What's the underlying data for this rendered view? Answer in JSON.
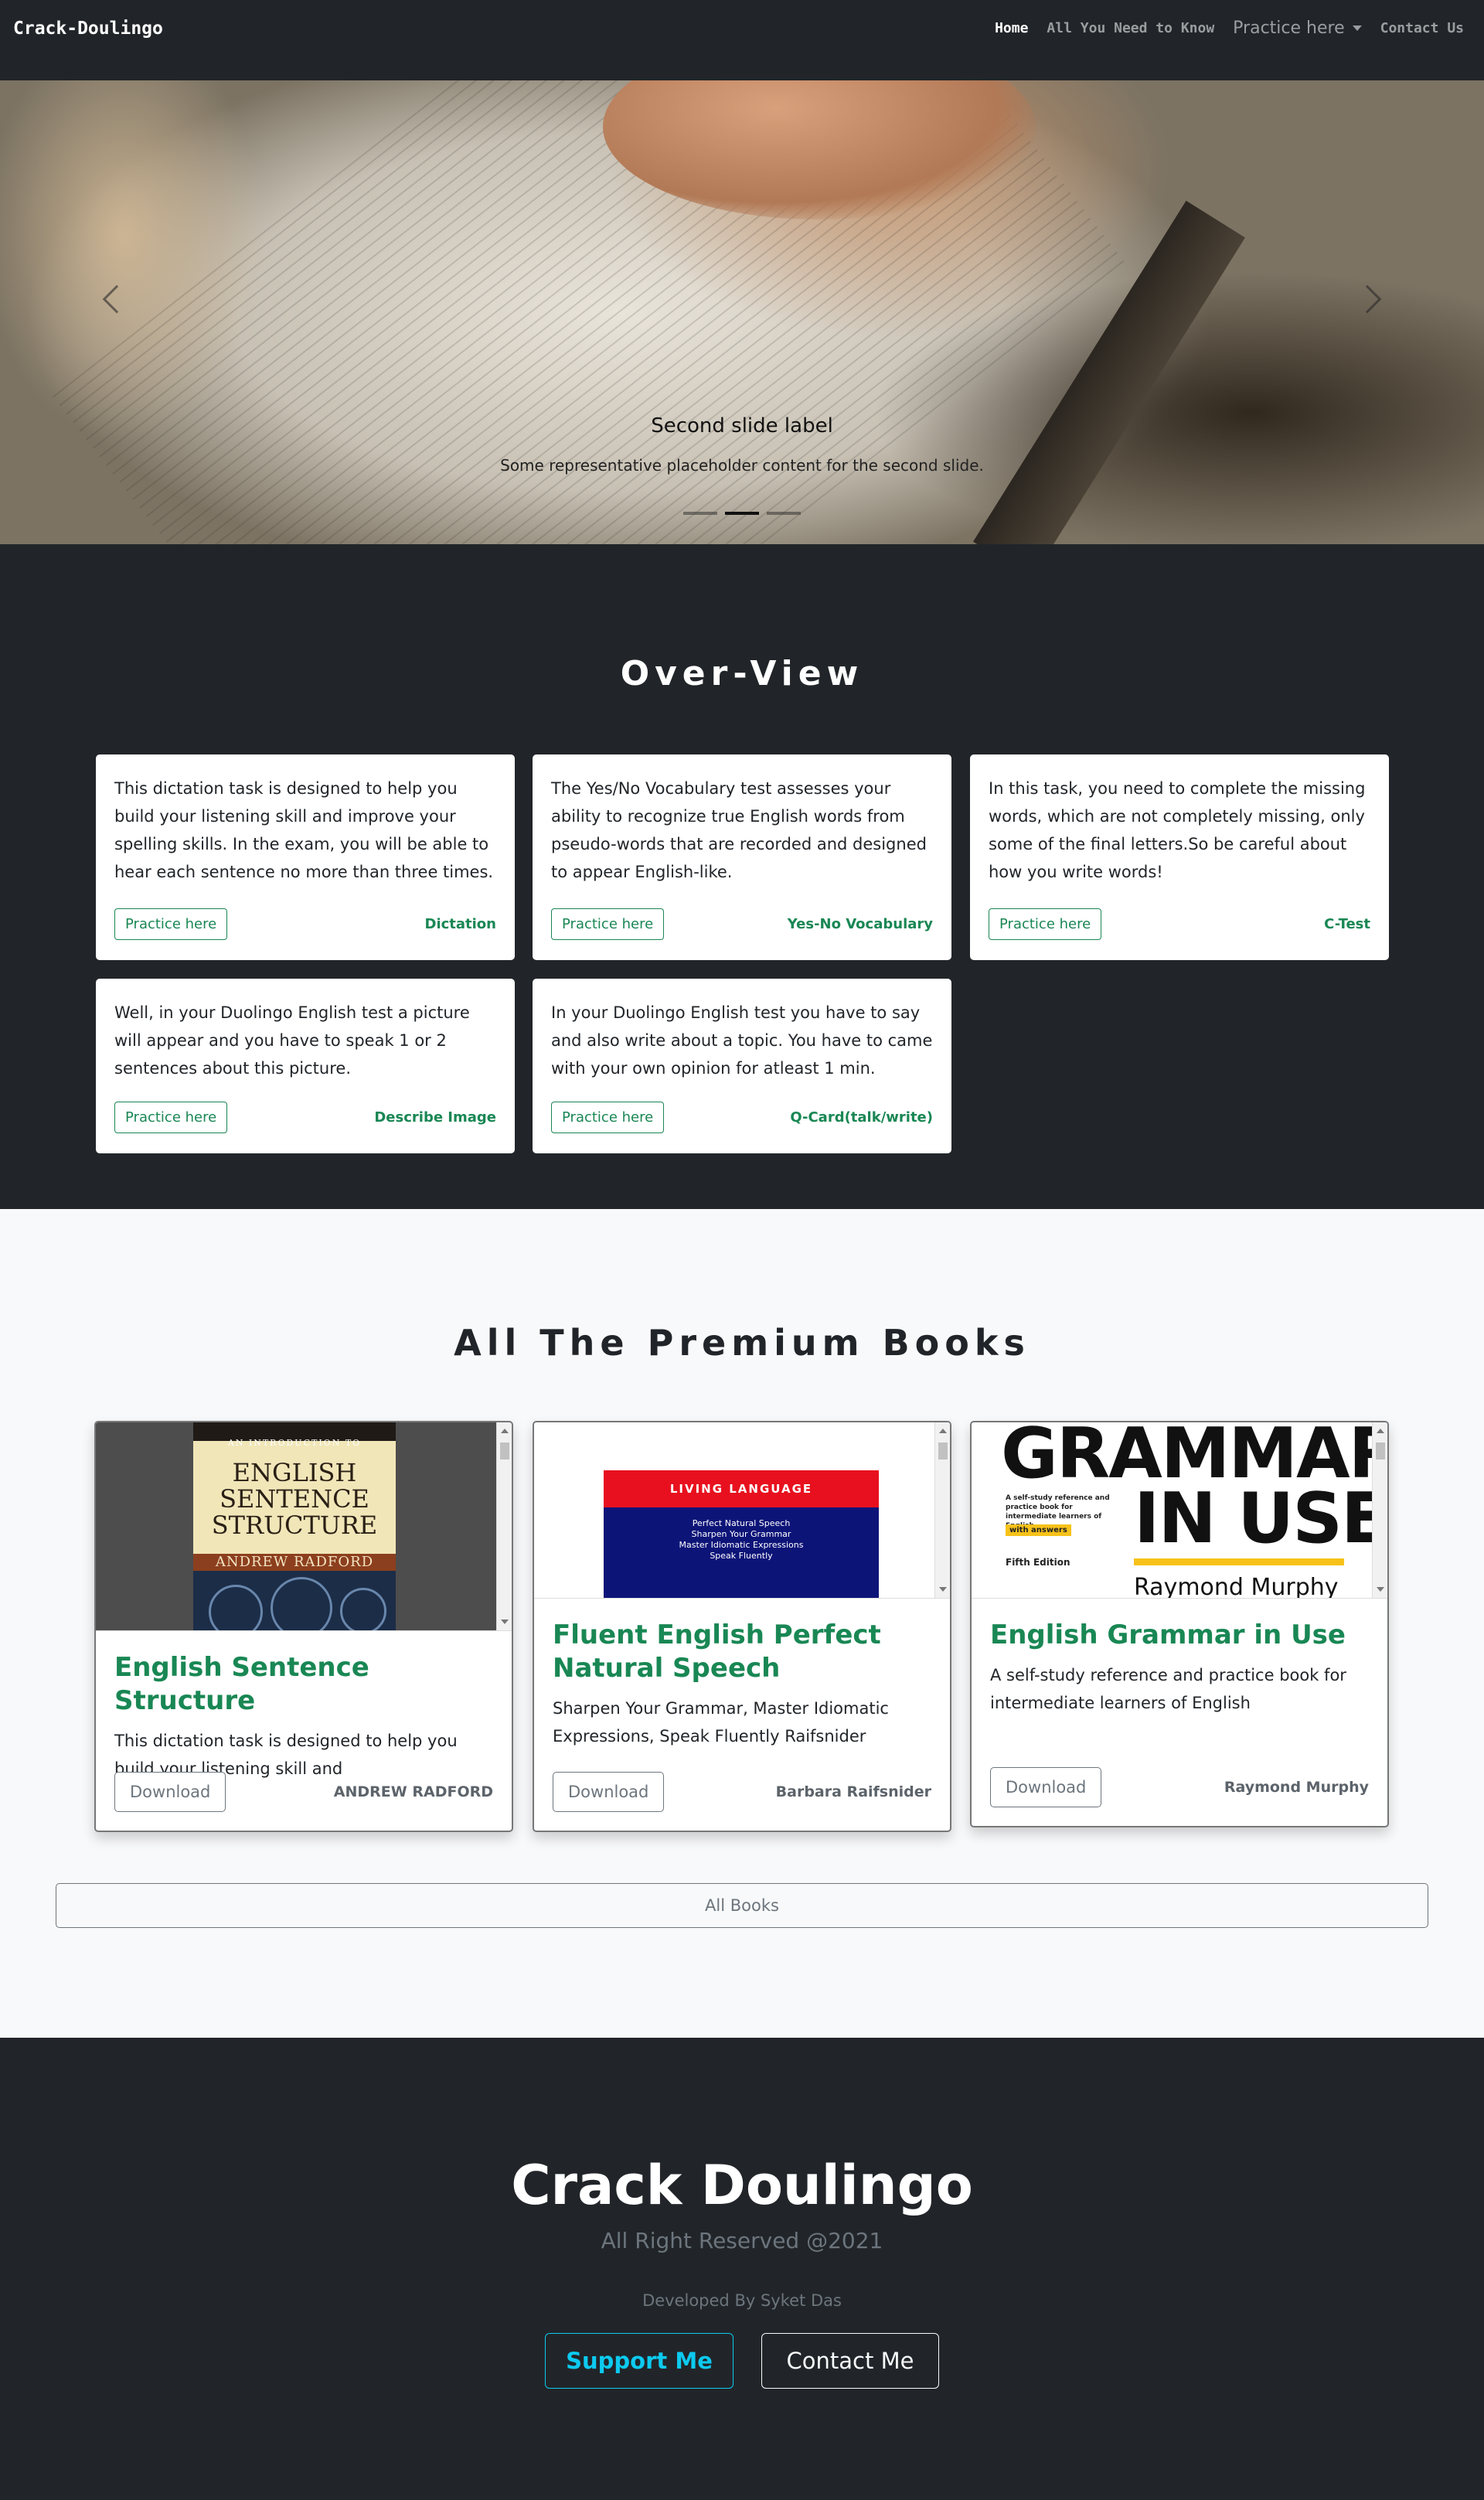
{
  "navbar": {
    "brand": "Crack-Doulingo",
    "links": [
      "Home",
      "All You Need to Know",
      "Practice here",
      "Contact Us"
    ]
  },
  "carousel": {
    "caption_title": "Second slide label",
    "caption_text": "Some representative placeholder content for the second slide.",
    "active_slide": 2,
    "slide_count": 3
  },
  "overview": {
    "title": "Over-View",
    "cards": [
      {
        "text": "This dictation task is designed to help you build your listening skill and improve your spelling skills. In the exam, you will be able to hear each sentence no more than three times.",
        "button": "Practice here",
        "tag": "Dictation"
      },
      {
        "text": "The Yes/No Vocabulary test assesses your ability to recognize true English words from pseudo-words that are recorded and designed to appear English-like.",
        "button": "Practice here",
        "tag": "Yes-No Vocabulary"
      },
      {
        "text": "In this task, you need to complete the missing words, which are not completely missing, only some of the final letters.So be careful about how you write words!",
        "button": "Practice here",
        "tag": "C-Test"
      },
      {
        "text": "Well, in your Duolingo English test a picture will appear and you have to speak 1 or 2 sentences about this picture.",
        "button": "Practice here",
        "tag": "Describe Image"
      },
      {
        "text": "In your Duolingo English test you have to say and also write about a topic. You have to came with your own opinion for atleast 1 min.",
        "button": "Practice here",
        "tag": "Q-Card(talk/write)"
      }
    ]
  },
  "books": {
    "title": "All The Premium Books",
    "items": [
      {
        "name": "English Sentence Structure",
        "desc": "This dictation task is designed to help you build your listening skill and",
        "button": "Download",
        "author": "ANDREW RADFORD",
        "cover": {
          "intro": "AN INTRODUCTION TO",
          "title": [
            "ENGLISH",
            "SENTENCE",
            "STRUCTURE"
          ],
          "author": "ANDREW RADFORD"
        }
      },
      {
        "name": "Fluent English Perfect Natural Speech",
        "desc": "Sharpen Your Grammar, Master Idiomatic Expressions, Speak Fluently Raifsnider",
        "button": "Download",
        "author": "Barbara Raifsnider",
        "cover": {
          "brand": "LIVING LANGUAGE",
          "lines": [
            "Perfect Natural Speech",
            "Sharpen Your Grammar",
            "Master Idiomatic Expressions",
            "Speak Fluently"
          ]
        }
      },
      {
        "name": "English Grammar in Use",
        "desc": "A self-study reference and practice book for intermediate learners of English",
        "button": "Download",
        "author": "Raymond Murphy",
        "cover": {
          "line1": "GRAMMAR",
          "line2": "IN USE",
          "small": "A self-study reference and practice book for intermediate learners of English",
          "badge": "with answers",
          "edition": "Fifth Edition",
          "author": "Raymond Murphy"
        }
      }
    ],
    "all_button": "All Books"
  },
  "footer": {
    "title": "Crack Doulingo",
    "rights": "All Right Reserved @2021",
    "developer": "Developed By Syket Das",
    "support_button": "Support Me",
    "contact_button": "Contact Me"
  },
  "colors": {
    "dark": "#212529",
    "success": "#198754",
    "info": "#0dcaf0",
    "secondary": "#6c757d",
    "light_bg": "#f8f9fa"
  }
}
